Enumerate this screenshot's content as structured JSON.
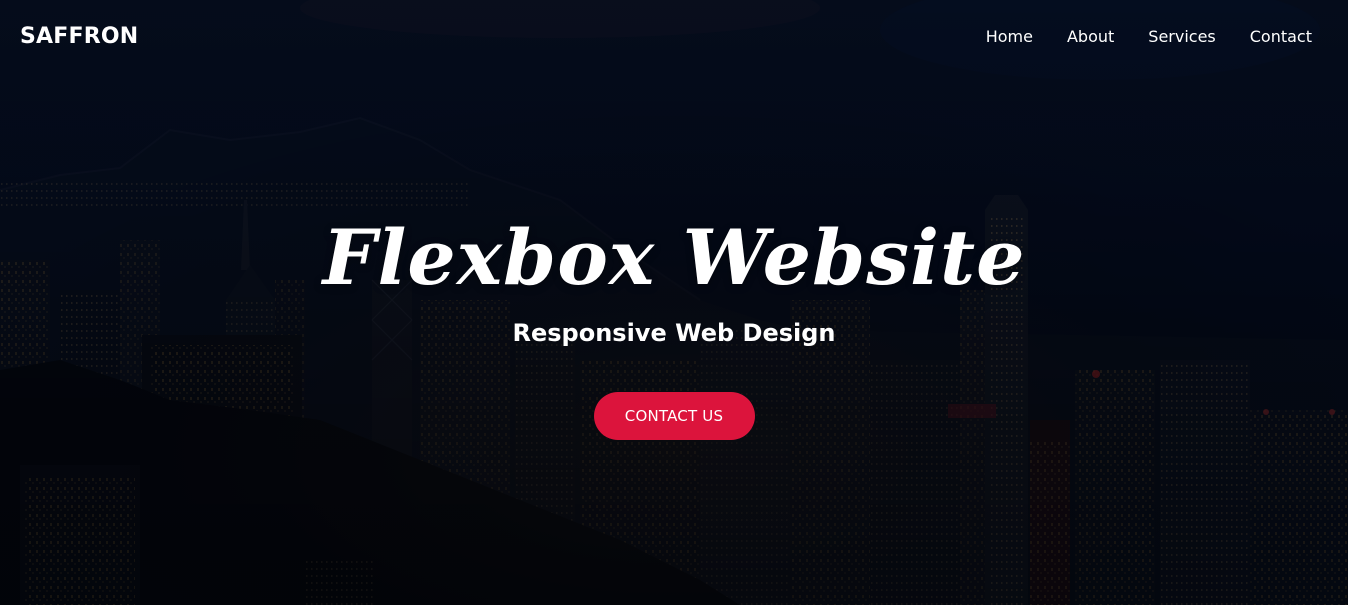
{
  "brand": {
    "name": "SAFFRON"
  },
  "nav": {
    "items": [
      {
        "label": "Home"
      },
      {
        "label": "About"
      },
      {
        "label": "Services"
      },
      {
        "label": "Contact"
      }
    ]
  },
  "hero": {
    "title": "Flexbox Website",
    "subtitle": "Responsive Web Design",
    "cta_label": "CONTACT US"
  },
  "colors": {
    "accent": "#dc143c",
    "text": "#ffffff",
    "overlay": "#020b1f"
  },
  "background": {
    "scene": "night-city-skyline"
  }
}
